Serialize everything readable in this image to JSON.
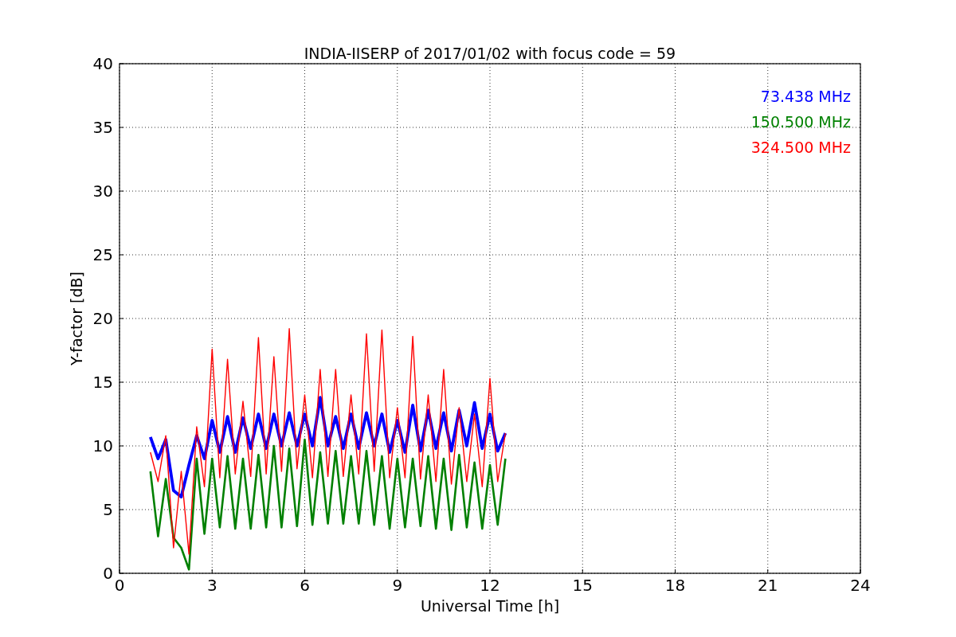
{
  "chart_data": {
    "type": "line",
    "grid": true,
    "title": "INDIA-IISERP of 2017/01/02 with focus code = 59",
    "xlabel": "Universal Time [h]",
    "ylabel": "Y-factor [dB]",
    "xlim": [
      0,
      24
    ],
    "ylim": [
      0,
      40
    ],
    "xticks": [
      0,
      3,
      6,
      9,
      12,
      15,
      18,
      21,
      24
    ],
    "yticks": [
      0,
      5,
      10,
      15,
      20,
      25,
      30,
      35,
      40
    ],
    "x": [
      1,
      1.25,
      1.5,
      1.75,
      2,
      2.25,
      2.5,
      2.75,
      3,
      3.25,
      3.5,
      3.75,
      4,
      4.25,
      4.5,
      4.75,
      5,
      5.25,
      5.5,
      5.75,
      6,
      6.25,
      6.5,
      6.75,
      7,
      7.25,
      7.5,
      7.75,
      8,
      8.25,
      8.5,
      8.75,
      9,
      9.25,
      9.5,
      9.75,
      10,
      10.25,
      10.5,
      10.75,
      11,
      11.25,
      11.5,
      11.75,
      12,
      12.25,
      12.5
    ],
    "series": [
      {
        "name": "73.438 MHz",
        "color": "#0000ff",
        "values": [
          10.7,
          9.0,
          10.5,
          6.5,
          6.0,
          8.5,
          10.8,
          9.0,
          12.0,
          9.5,
          12.3,
          9.5,
          12.2,
          9.8,
          12.5,
          9.8,
          12.5,
          10,
          12.6,
          10,
          12.5,
          10,
          13.8,
          10,
          12.3,
          9.8,
          12.5,
          9.8,
          12.6,
          10,
          12.5,
          9.5,
          12.0,
          9.5,
          13.2,
          9.6,
          12.8,
          9.8,
          12.6,
          9.6,
          12.8,
          10,
          13.4,
          9.8,
          12.5,
          9.6,
          11
        ]
      },
      {
        "name": "150.500 MHz",
        "color": "#008000",
        "values": [
          8,
          2.9,
          7.4,
          2.8,
          2.0,
          0.3,
          9.0,
          3.1,
          9.0,
          3.6,
          9.2,
          3.5,
          9.0,
          3.5,
          9.3,
          3.6,
          10.0,
          3.6,
          9.8,
          3.7,
          10.5,
          3.8,
          9.5,
          3.9,
          9.6,
          3.9,
          9.2,
          3.9,
          9.6,
          3.8,
          9.2,
          3.5,
          9.0,
          3.6,
          9.0,
          3.7,
          9.2,
          3.5,
          9.0,
          3.4,
          9.3,
          3.6,
          8.7,
          3.5,
          8.5,
          3.8,
          9.0
        ]
      },
      {
        "name": "324.500 MHz",
        "color": "#ff0000",
        "values": [
          9.5,
          7.2,
          10.8,
          2.0,
          8.0,
          1.5,
          11.5,
          6.8,
          17.6,
          7.5,
          16.8,
          7.8,
          13.5,
          7.6,
          18.5,
          7.8,
          17.0,
          8.0,
          19.2,
          8.2,
          14.0,
          7.5,
          16.0,
          7.6,
          16.0,
          7.6,
          14.0,
          7.8,
          18.8,
          8.0,
          19.1,
          7.5,
          13.0,
          7.5,
          18.6,
          7.4,
          14.0,
          7.2,
          16.0,
          7.0,
          13.0,
          7.2,
          12.5,
          6.8,
          15.3,
          7.2,
          11.0
        ]
      }
    ]
  }
}
